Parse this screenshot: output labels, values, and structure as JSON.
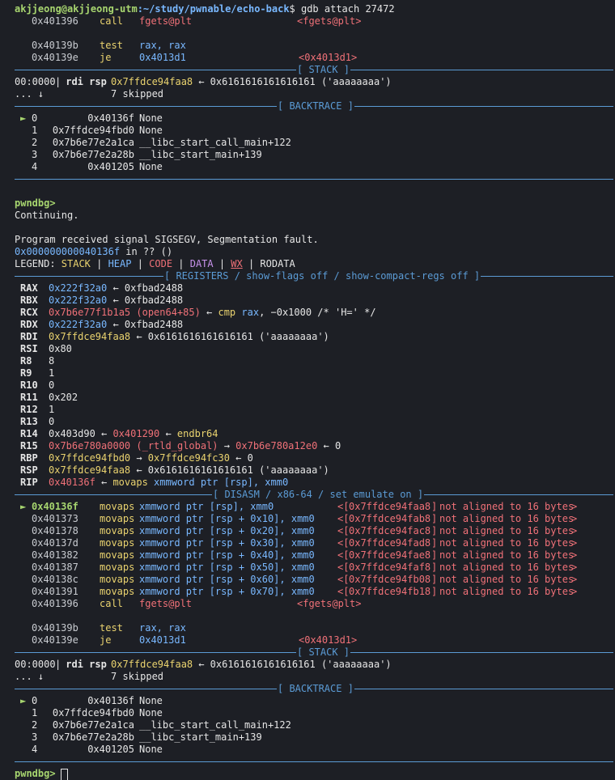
{
  "prompt": {
    "user_host": "akjjeong@akjjeong-utm",
    "path": ":~/study/pwnable/echo-back",
    "dollar": "$",
    "command": " gdb attach 27472"
  },
  "first_disasm_tail": [
    {
      "addr": "0x401396",
      "mnemonic": "call",
      "operand": "fgets@plt",
      "target": "<fgets@plt>"
    },
    {
      "addr": "0x40139b",
      "mnemonic": "test",
      "operand": "rax, rax",
      "target": ""
    },
    {
      "addr": "0x40139e",
      "mnemonic": "je",
      "operand": "0x4013d1",
      "target": "<0x4013d1>"
    }
  ],
  "sections": {
    "stack": "[ STACK ]",
    "backtrace": "[ BACKTRACE ]",
    "registers": "[ REGISTERS / show-flags off / show-compact-regs off ]",
    "disasm": "[ DISASM / x86-64 / set emulate on ]"
  },
  "stack_line": {
    "prefix": "00:0000",
    "bar": "|",
    "regs": " rdi rsp ",
    "addr": "0x7ffdce94faa8",
    "arrow": " ← 0x6161616161616161 ('aaaaaaaa')"
  },
  "stack_skip": {
    "dots": "... ↓",
    "text": "7 skipped"
  },
  "backtrace": [
    {
      "marker": "►",
      "idx": "0",
      "addr": "0x40136f",
      "sym": "None"
    },
    {
      "marker": "",
      "idx": "1",
      "addr": "0x7ffdce94fbd0",
      "sym": "None"
    },
    {
      "marker": "",
      "idx": "2",
      "addr": "0x7b6e77e2a1ca",
      "sym": "__libc_start_call_main+122"
    },
    {
      "marker": "",
      "idx": "3",
      "addr": "0x7b6e77e2a28b",
      "sym": "__libc_start_main+139"
    },
    {
      "marker": "",
      "idx": "4",
      "addr": "0x401205",
      "sym": "None"
    }
  ],
  "pwndbg_prompt": "pwndbg>",
  "continuing": "Continuing.",
  "signal_msg": "Program received signal SIGSEGV, Segmentation fault.",
  "location": {
    "addr": "0x000000000040136f",
    "rest": " in ?? ()"
  },
  "legend": {
    "label": "LEGEND: ",
    "stack": "STACK",
    "heap": "HEAP",
    "code": "CODE",
    "data": "DATA",
    "wx": "WX",
    "rodata": "RODATA",
    "sep": " | "
  },
  "registers": [
    {
      "name": "RAX",
      "parts": [
        [
          "blue",
          "0x222f32a0"
        ],
        [
          "white",
          " ← 0xfbad2488"
        ]
      ]
    },
    {
      "name": "RBX",
      "parts": [
        [
          "blue",
          "0x222f32a0"
        ],
        [
          "white",
          " ← 0xfbad2488"
        ]
      ]
    },
    {
      "name": "RCX",
      "parts": [
        [
          "red",
          "0x7b6e77f1b1a5 (open64+85)"
        ],
        [
          "white",
          " ← "
        ],
        [
          "yellow",
          "cmp"
        ],
        [
          "white",
          " "
        ],
        [
          "blue",
          "rax"
        ],
        [
          "white",
          ", −0x1000 /* 'H=' */"
        ]
      ]
    },
    {
      "name": "RDX",
      "parts": [
        [
          "blue",
          "0x222f32a0"
        ],
        [
          "white",
          " ← 0xfbad2488"
        ]
      ]
    },
    {
      "name": "RDI",
      "parts": [
        [
          "yellow",
          "0x7ffdce94faa8"
        ],
        [
          "white",
          " ← 0x6161616161616161 ('aaaaaaaa')"
        ]
      ]
    },
    {
      "name": "RSI",
      "parts": [
        [
          "white",
          "0x80"
        ]
      ]
    },
    {
      "name": "R8",
      "parts": [
        [
          "white",
          "8"
        ]
      ]
    },
    {
      "name": "R9",
      "parts": [
        [
          "white",
          "1"
        ]
      ]
    },
    {
      "name": "R10",
      "parts": [
        [
          "white",
          "0"
        ]
      ]
    },
    {
      "name": "R11",
      "parts": [
        [
          "white",
          "0x202"
        ]
      ]
    },
    {
      "name": "R12",
      "parts": [
        [
          "white",
          "1"
        ]
      ]
    },
    {
      "name": "R13",
      "parts": [
        [
          "white",
          "0"
        ]
      ]
    },
    {
      "name": "R14",
      "parts": [
        [
          "white",
          "0x403d90 ← "
        ],
        [
          "red",
          "0x401290"
        ],
        [
          "white",
          " ← "
        ],
        [
          "yellow",
          "endbr64"
        ]
      ]
    },
    {
      "name": "R15",
      "parts": [
        [
          "red",
          "0x7b6e780a0000 (_rtld_global)"
        ],
        [
          "white",
          " → "
        ],
        [
          "red",
          "0x7b6e780a12e0"
        ],
        [
          "white",
          " ← 0"
        ]
      ]
    },
    {
      "name": "RBP",
      "parts": [
        [
          "yellow",
          "0x7ffdce94fbd0"
        ],
        [
          "white",
          " → "
        ],
        [
          "yellow",
          "0x7ffdce94fc30"
        ],
        [
          "white",
          " ← 0"
        ]
      ]
    },
    {
      "name": "RSP",
      "parts": [
        [
          "yellow",
          "0x7ffdce94faa8"
        ],
        [
          "white",
          " ← 0x6161616161616161 ('aaaaaaaa')"
        ]
      ]
    },
    {
      "name": "RIP",
      "parts": [
        [
          "red",
          "0x40136f"
        ],
        [
          "white",
          " ← "
        ],
        [
          "yellow",
          "movaps"
        ],
        [
          "white",
          " "
        ],
        [
          "blue",
          "xmmword ptr [rsp], xmm0"
        ]
      ]
    }
  ],
  "disasm": [
    {
      "cur": true,
      "addr": "0x40136f",
      "mn": "movaps",
      "op": "xmmword ptr [rsp], xmm0",
      "note_addr": "0x7ffdce94faa8",
      "note": "not aligned to 16 bytes"
    },
    {
      "cur": false,
      "addr": "0x401373",
      "mn": "movaps",
      "op": "xmmword ptr [rsp + 0x10], xmm0",
      "note_addr": "0x7ffdce94fab8",
      "note": "not aligned to 16 bytes"
    },
    {
      "cur": false,
      "addr": "0x401378",
      "mn": "movaps",
      "op": "xmmword ptr [rsp + 0x20], xmm0",
      "note_addr": "0x7ffdce94fac8",
      "note": "not aligned to 16 bytes"
    },
    {
      "cur": false,
      "addr": "0x40137d",
      "mn": "movaps",
      "op": "xmmword ptr [rsp + 0x30], xmm0",
      "note_addr": "0x7ffdce94fad8",
      "note": "not aligned to 16 bytes"
    },
    {
      "cur": false,
      "addr": "0x401382",
      "mn": "movaps",
      "op": "xmmword ptr [rsp + 0x40], xmm0",
      "note_addr": "0x7ffdce94fae8",
      "note": "not aligned to 16 bytes"
    },
    {
      "cur": false,
      "addr": "0x401387",
      "mn": "movaps",
      "op": "xmmword ptr [rsp + 0x50], xmm0",
      "note_addr": "0x7ffdce94faf8",
      "note": "not aligned to 16 bytes"
    },
    {
      "cur": false,
      "addr": "0x40138c",
      "mn": "movaps",
      "op": "xmmword ptr [rsp + 0x60], xmm0",
      "note_addr": "0x7ffdce94fb08",
      "note": "not aligned to 16 bytes"
    },
    {
      "cur": false,
      "addr": "0x401391",
      "mn": "movaps",
      "op": "xmmword ptr [rsp + 0x70], xmm0",
      "note_addr": "0x7ffdce94fb18",
      "note": "not aligned to 16 bytes"
    }
  ],
  "disasm_after": [
    {
      "addr": "0x401396",
      "mnemonic": "call",
      "operand": "fgets@plt",
      "target": "<fgets@plt>"
    },
    {
      "addr": "0x40139b",
      "mnemonic": "test",
      "operand": "rax, rax",
      "target": ""
    },
    {
      "addr": "0x40139e",
      "mnemonic": "je",
      "operand": "0x4013d1",
      "target": "<0x4013d1>"
    }
  ]
}
